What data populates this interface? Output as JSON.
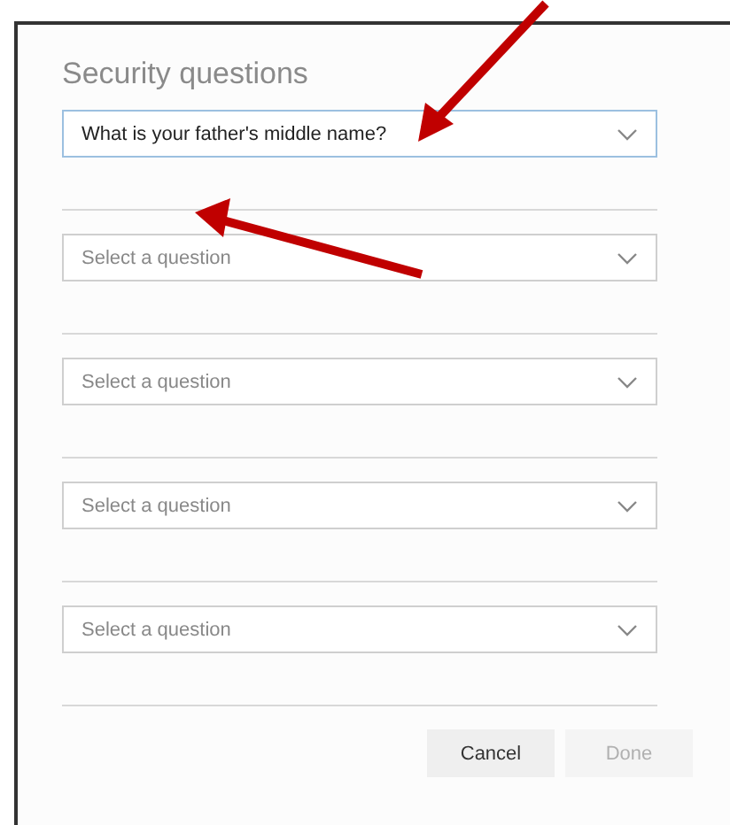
{
  "dialog": {
    "title": "Security questions",
    "questions": [
      {
        "value": "What is your father's middle name?",
        "focused": true
      },
      {
        "placeholder": "Select a question",
        "focused": false
      },
      {
        "placeholder": "Select a question",
        "focused": false
      },
      {
        "placeholder": "Select a question",
        "focused": false
      },
      {
        "placeholder": "Select a question",
        "focused": false
      }
    ],
    "buttons": [
      {
        "label": "Cancel",
        "disabled": false
      },
      {
        "label": "Done",
        "disabled": true
      }
    ]
  }
}
